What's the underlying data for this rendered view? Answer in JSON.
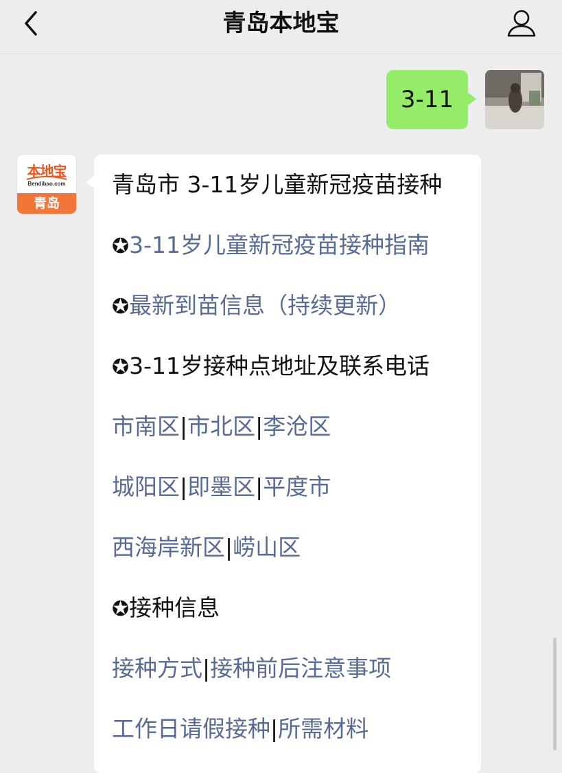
{
  "header": {
    "title": "青岛本地宝",
    "back_icon": "chevron-left-icon",
    "profile_icon": "person-icon"
  },
  "chat": {
    "sent_message": "3-11",
    "bot_avatar": {
      "logo_text": "本地宝",
      "logo_subtext": "Bendibao.com",
      "city": "青岛"
    },
    "reply": {
      "headline": "青岛市 3-11岁儿童新冠疫苗接种",
      "star": "✪",
      "guide_link": "3-11岁儿童新冠疫苗接种指南",
      "latest_link": "最新到苗信息（持续更新）",
      "sites_heading": "3-11岁接种点地址及联系电话",
      "districts_row1": [
        "市南区",
        "市北区",
        "李沧区"
      ],
      "districts_row2": [
        "城阳区",
        "即墨区",
        "平度市"
      ],
      "districts_row3": [
        "西海岸新区",
        "崂山区"
      ],
      "info_heading": "接种信息",
      "info_row1": [
        "接种方式",
        "接种前后注意事项"
      ],
      "info_row2": [
        "工作日请假接种",
        "所需材料"
      ],
      "separator": "|"
    }
  },
  "colors": {
    "background": "#ededed",
    "sent_bubble": "#95ec69",
    "link": "#576b95",
    "logo_orange": "#f2763a"
  }
}
